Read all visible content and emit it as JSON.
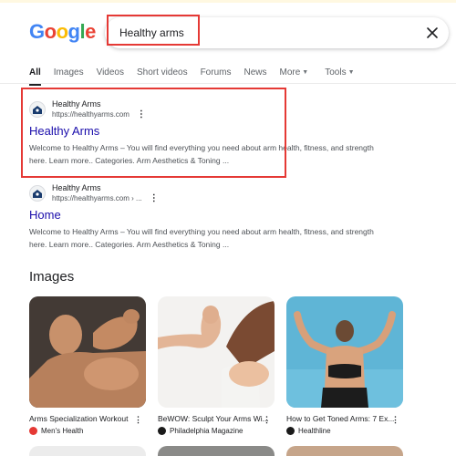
{
  "logo": {
    "letters": [
      "G",
      "o",
      "o",
      "g",
      "l",
      "e"
    ]
  },
  "search": {
    "query": "Healthy arms",
    "close_icon": "close-icon"
  },
  "tabs": [
    {
      "label": "All",
      "active": true
    },
    {
      "label": "Images"
    },
    {
      "label": "Videos"
    },
    {
      "label": "Short videos"
    },
    {
      "label": "Forums"
    },
    {
      "label": "News"
    },
    {
      "label": "More",
      "has_caret": true
    },
    {
      "label": "Tools",
      "has_caret": true
    }
  ],
  "results": [
    {
      "site_name": "Healthy Arms",
      "url": "https://healthyarms.com",
      "title": "Healthy Arms",
      "snippet_line1": "Welcome to Healthy Arms – You will find everything you need about arm health, fitness, and strength",
      "snippet_line2": "here. Learn more.. Categories. Arm Aesthetics & Toning ..."
    },
    {
      "site_name": "Healthy Arms",
      "url": "https://healthyarms.com › ...",
      "title": "Home",
      "snippet_line1": "Welcome to Healthy Arms – You will find everything you need about arm health, fitness, and strength",
      "snippet_line2": "here. Learn more.. Categories. Arm Aesthetics & Toning ..."
    }
  ],
  "images_section": {
    "heading": "Images",
    "cards": [
      {
        "title": "Arms Specialization Workout",
        "source": "Men's Health",
        "source_color": "#e53935"
      },
      {
        "title": "BeWOW: Sculpt Your Arms Wi...",
        "source": "Philadelphia Magazine",
        "source_color": "#1a1a1a"
      },
      {
        "title": "How to Get Toned Arms: 7 Ex...",
        "source": "Healthline",
        "source_color": "#1a1a1a"
      }
    ]
  },
  "colors": {
    "highlight": "#e53935",
    "link": "#1a0dab",
    "accent": "#4285f4"
  }
}
